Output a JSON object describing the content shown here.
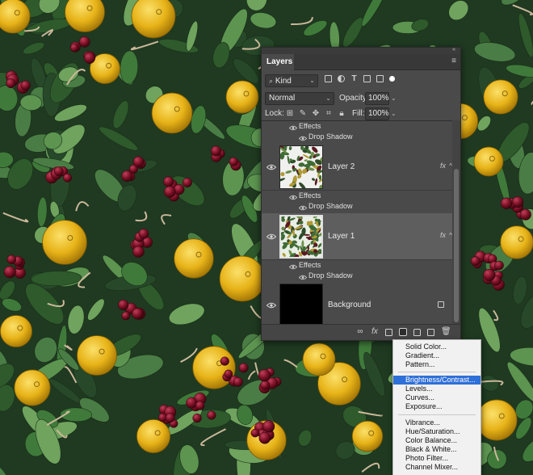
{
  "panel": {
    "tab": "Layers",
    "kind_filter": "Kind",
    "blend_mode": "Normal",
    "opacity_label": "Opacity:",
    "opacity_value": "100%",
    "lock_label": "Lock:",
    "fill_label": "Fill:",
    "fill_value": "100%"
  },
  "layers": [
    {
      "name": "",
      "effects": "Effects",
      "effect": "Drop Shadow",
      "partial": true
    },
    {
      "name": "Layer 2",
      "fx": "fx",
      "effects": "Effects",
      "effect": "Drop Shadow"
    },
    {
      "name": "Layer 1",
      "fx": "fx",
      "effects": "Effects",
      "effect": "Drop Shadow",
      "selected": true
    },
    {
      "name": "Background",
      "locked": true
    }
  ],
  "footer": {
    "link": "∞",
    "fx": "fx",
    "mask": "",
    "adjust": "",
    "group": "",
    "new": "",
    "trash": ""
  },
  "menu": {
    "items": [
      "Solid Color...",
      "Gradient...",
      "Pattern...",
      "Brightness/Contrast...",
      "Levels...",
      "Curves...",
      "Exposure...",
      "Vibrance...",
      "Hue/Saturation...",
      "Color Balance...",
      "Black & White...",
      "Photo Filter...",
      "Channel Mixer..."
    ],
    "highlighted": "Brightness/Contrast..."
  },
  "icons": {
    "eye": "eye-icon",
    "lock": "lock-icon",
    "brush": "brush-icon",
    "move": "move-icon",
    "artboard": "artboard-icon"
  },
  "colors": {
    "panel_bg": "#4a4a4a",
    "selected_row": "#5e5e5e",
    "menu_highlight": "#2f6fd8"
  }
}
